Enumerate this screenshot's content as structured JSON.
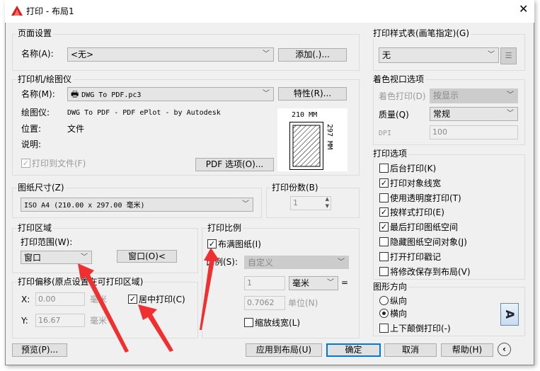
{
  "title": "打印 - 布局1",
  "page_setup": {
    "label": "页面设置",
    "name_label": "名称(A):",
    "name_value": "<无>",
    "add_button": "添加(.)..."
  },
  "printer": {
    "label": "打印机/绘图仪",
    "name_label": "名称(M):",
    "name_value": "DWG To PDF.pc3",
    "properties_button": "特性(R)...",
    "plotter_label": "绘图仪:",
    "plotter_value": "DWG To PDF - PDF ePlot - by Autodesk",
    "location_label": "位置:",
    "location_value": "文件",
    "description_label": "说明:",
    "print_to_file": "打印到文件(F)",
    "pdf_options_button": "PDF 选项(O)...",
    "preview_width": "210 MM",
    "preview_height": "297 MM"
  },
  "paper_size": {
    "label": "图纸尺寸(Z)",
    "value": "ISO A4 (210.00 x 297.00 毫米)"
  },
  "copies": {
    "label": "打印份数(B)",
    "value": "1"
  },
  "plot_area": {
    "label": "打印区域",
    "range_label": "打印范围(W):",
    "range_value": "窗口",
    "window_button": "窗口(O)<"
  },
  "plot_offset": {
    "label": "打印偏移(原点设置在可打印区域)",
    "x_label": "X:",
    "x_value": "0.00",
    "x_unit": "毫米",
    "y_label": "Y:",
    "y_value": "16.67",
    "y_unit": "毫米",
    "center_label": "居中打印(C)"
  },
  "plot_scale": {
    "label": "打印比例",
    "fit_label": "布满图纸(I)",
    "scale_label": "比例(S):",
    "scale_value": "自定义",
    "value1": "1",
    "unit_value": "毫米",
    "equals": "=",
    "value2": "0.7062",
    "unit2_label": "单位(N)",
    "scale_lineweights": "缩放线宽(L)"
  },
  "plot_style": {
    "label": "打印样式表(画笔指定)(G)",
    "value": "无"
  },
  "shaded": {
    "label": "着色视口选项",
    "shade_label": "着色打印(D)",
    "shade_value": "按显示",
    "quality_label": "质量(Q)",
    "quality_value": "常规",
    "dpi_label": "DPI",
    "dpi_value": "100"
  },
  "options": {
    "label": "打印选项",
    "items": [
      {
        "label": "后台打印(K)",
        "checked": false
      },
      {
        "label": "打印对象线宽",
        "checked": true
      },
      {
        "label": "使用透明度打印(T)",
        "checked": false
      },
      {
        "label": "按样式打印(E)",
        "checked": true
      },
      {
        "label": "最后打印图纸空间",
        "checked": true
      },
      {
        "label": "隐藏图纸空间对象(J)",
        "checked": false
      },
      {
        "label": "打开打印戳记",
        "checked": false
      },
      {
        "label": "将修改保存到布局(V)",
        "checked": false
      }
    ]
  },
  "orientation": {
    "label": "图形方向",
    "portrait": "纵向",
    "landscape": "横向",
    "upside_down": "上下颠倒打印(-)",
    "icon_letter": "A"
  },
  "buttons": {
    "preview": "预览(P)...",
    "apply": "应用到布局(U)",
    "ok": "确定",
    "cancel": "取消",
    "help": "帮助(H)"
  },
  "colors": {
    "accent": "#0078d7",
    "arrow": "#f03030"
  }
}
